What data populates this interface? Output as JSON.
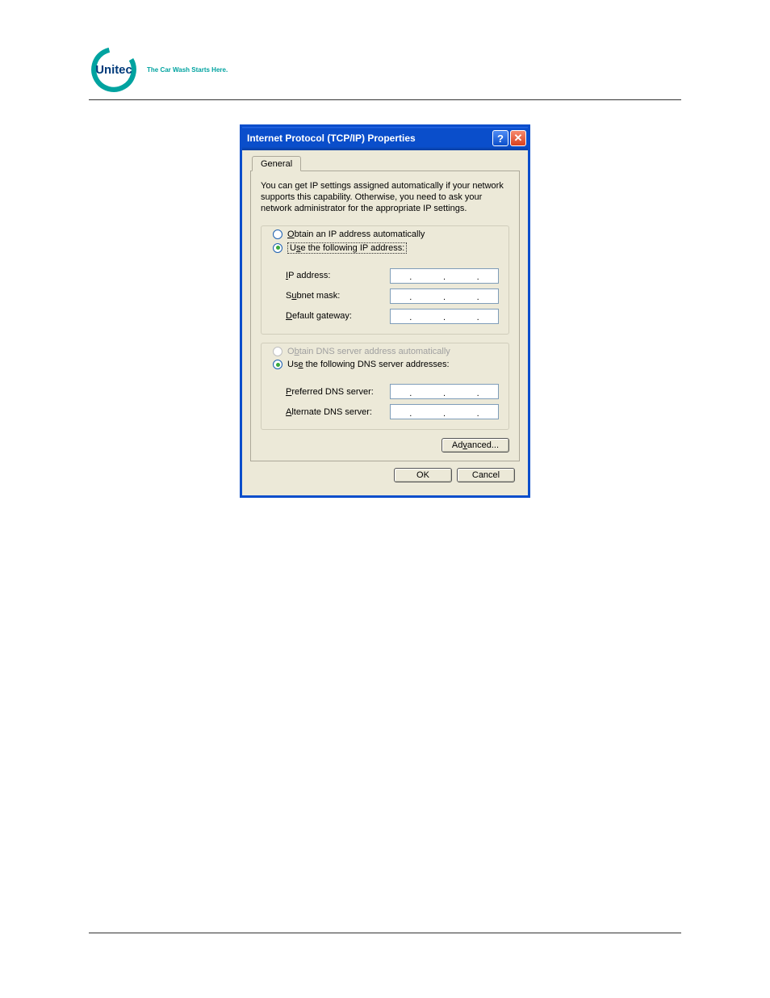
{
  "header": {
    "brand": "Unitec",
    "tagline": "The Car Wash Starts Here."
  },
  "dialog": {
    "title": "Internet Protocol (TCP/IP) Properties",
    "help_symbol": "?",
    "close_symbol": "✕",
    "tab_general": "General",
    "description": "You can get IP settings assigned automatically if your network supports this capability. Otherwise, you need to ask your network administrator for the appropriate IP settings.",
    "ip_group": {
      "obtain_pre": "O",
      "obtain_post": "btain an IP address automatically",
      "static_pre": "U",
      "static_mid": "s",
      "static_post": "e the following IP address:",
      "ip_pre": "I",
      "ip_post": "P address:",
      "subnet_pre": "S",
      "subnet_mid": "u",
      "subnet_post": "bnet mask:",
      "gateway_pre": "D",
      "gateway_post": "efault gateway:"
    },
    "dns_group": {
      "obtain_pre": "O",
      "obtain_mid": "b",
      "obtain_post": "tain DNS server address automatically",
      "static_pre": "Us",
      "static_mid": "e",
      "static_post": " the following DNS server addresses:",
      "pref_pre": "P",
      "pref_post": "referred DNS server:",
      "alt_pre": "A",
      "alt_post": "lternate DNS server:"
    },
    "advanced_pre": "Ad",
    "advanced_mid": "v",
    "advanced_post": "anced...",
    "ok": "OK",
    "cancel": "Cancel",
    "dot": "."
  }
}
